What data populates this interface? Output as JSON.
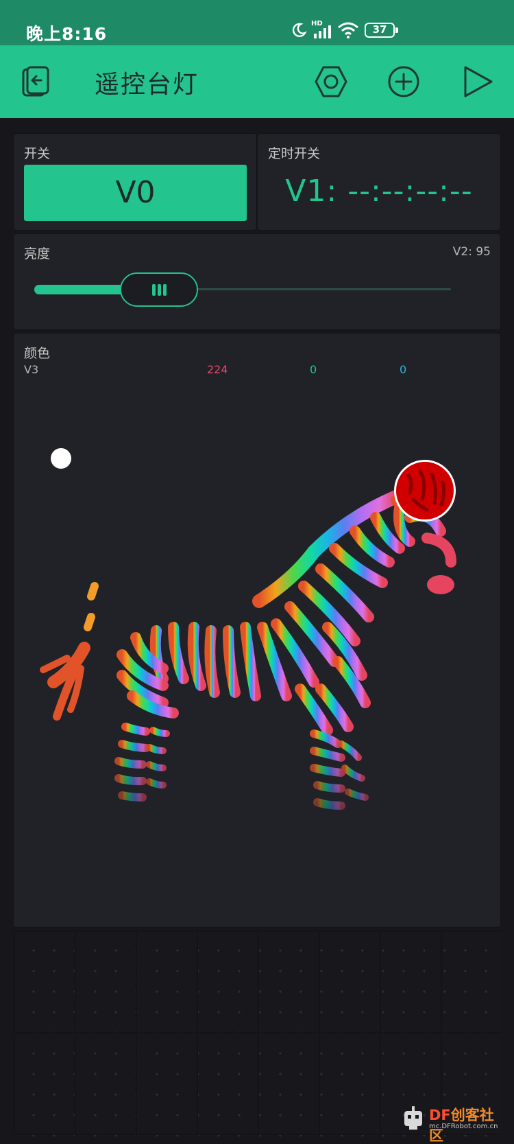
{
  "status_bar": {
    "time": "晚上8:16",
    "network": "HD",
    "battery": "37"
  },
  "header": {
    "title": "遥控台灯",
    "icons": [
      "exit-project-icon",
      "settings-hex-icon",
      "add-widget-icon",
      "play-icon"
    ]
  },
  "widgets": {
    "switch": {
      "label": "开关",
      "button_text": "V0"
    },
    "timer": {
      "label": "定时开关",
      "value": "V1: --:--:--:--"
    },
    "brightness": {
      "label": "亮度",
      "value_text": "V2: 95",
      "level_fraction": 0.3
    },
    "color": {
      "label": "颜色",
      "pin": "V3",
      "r": "224",
      "g": "0",
      "b": "0",
      "selected_color": "#e00000"
    }
  },
  "watermark": {
    "brand_df": "DF",
    "brand_cn": "创客社区",
    "site": "mc.DFRobot.com.cn"
  },
  "colors": {
    "accent": "#23c48e",
    "status_bar": "#1f8a66",
    "widget_bg": "#212227",
    "background": "#17171b",
    "r_text": "#e84a6a",
    "g_text": "#23c48e",
    "b_text": "#2bb5e8"
  }
}
